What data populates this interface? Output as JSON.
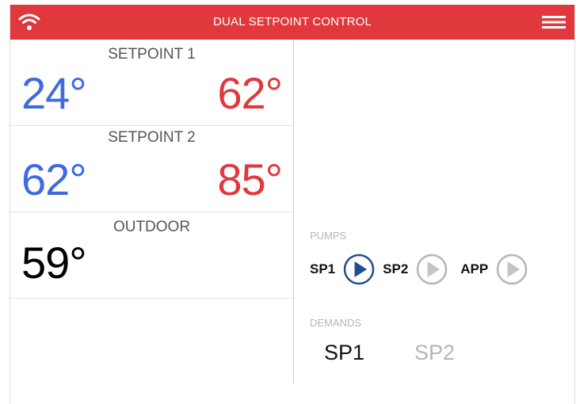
{
  "header": {
    "title": "DUAL SETPOINT CONTROL",
    "wifi_icon": "wifi-icon",
    "menu_icon": "hamburger-menu-icon",
    "color": "#e0383c"
  },
  "setpoint1": {
    "label": "SETPOINT 1",
    "low": "24°",
    "high": "62°"
  },
  "setpoint2": {
    "label": "SETPOINT 2",
    "low": "62°",
    "high": "85°"
  },
  "outdoor": {
    "label": "OUTDOOR",
    "temp": "59°"
  },
  "colors": {
    "low": "#3f6ae0",
    "high": "#e0383c",
    "active_pump": "#1f4e8c",
    "inactive": "#b5b5b5"
  },
  "pumps": {
    "label": "PUMPS",
    "items": [
      {
        "name": "SP1",
        "state": "active",
        "icon": "play-circle-icon"
      },
      {
        "name": "SP2",
        "state": "inactive",
        "icon": "play-circle-icon"
      },
      {
        "name": "APP",
        "state": "inactive",
        "icon": "play-circle-icon"
      }
    ]
  },
  "demands": {
    "label": "DEMANDS",
    "items": [
      {
        "name": "SP1",
        "state": "active"
      },
      {
        "name": "SP2",
        "state": "inactive"
      }
    ]
  }
}
